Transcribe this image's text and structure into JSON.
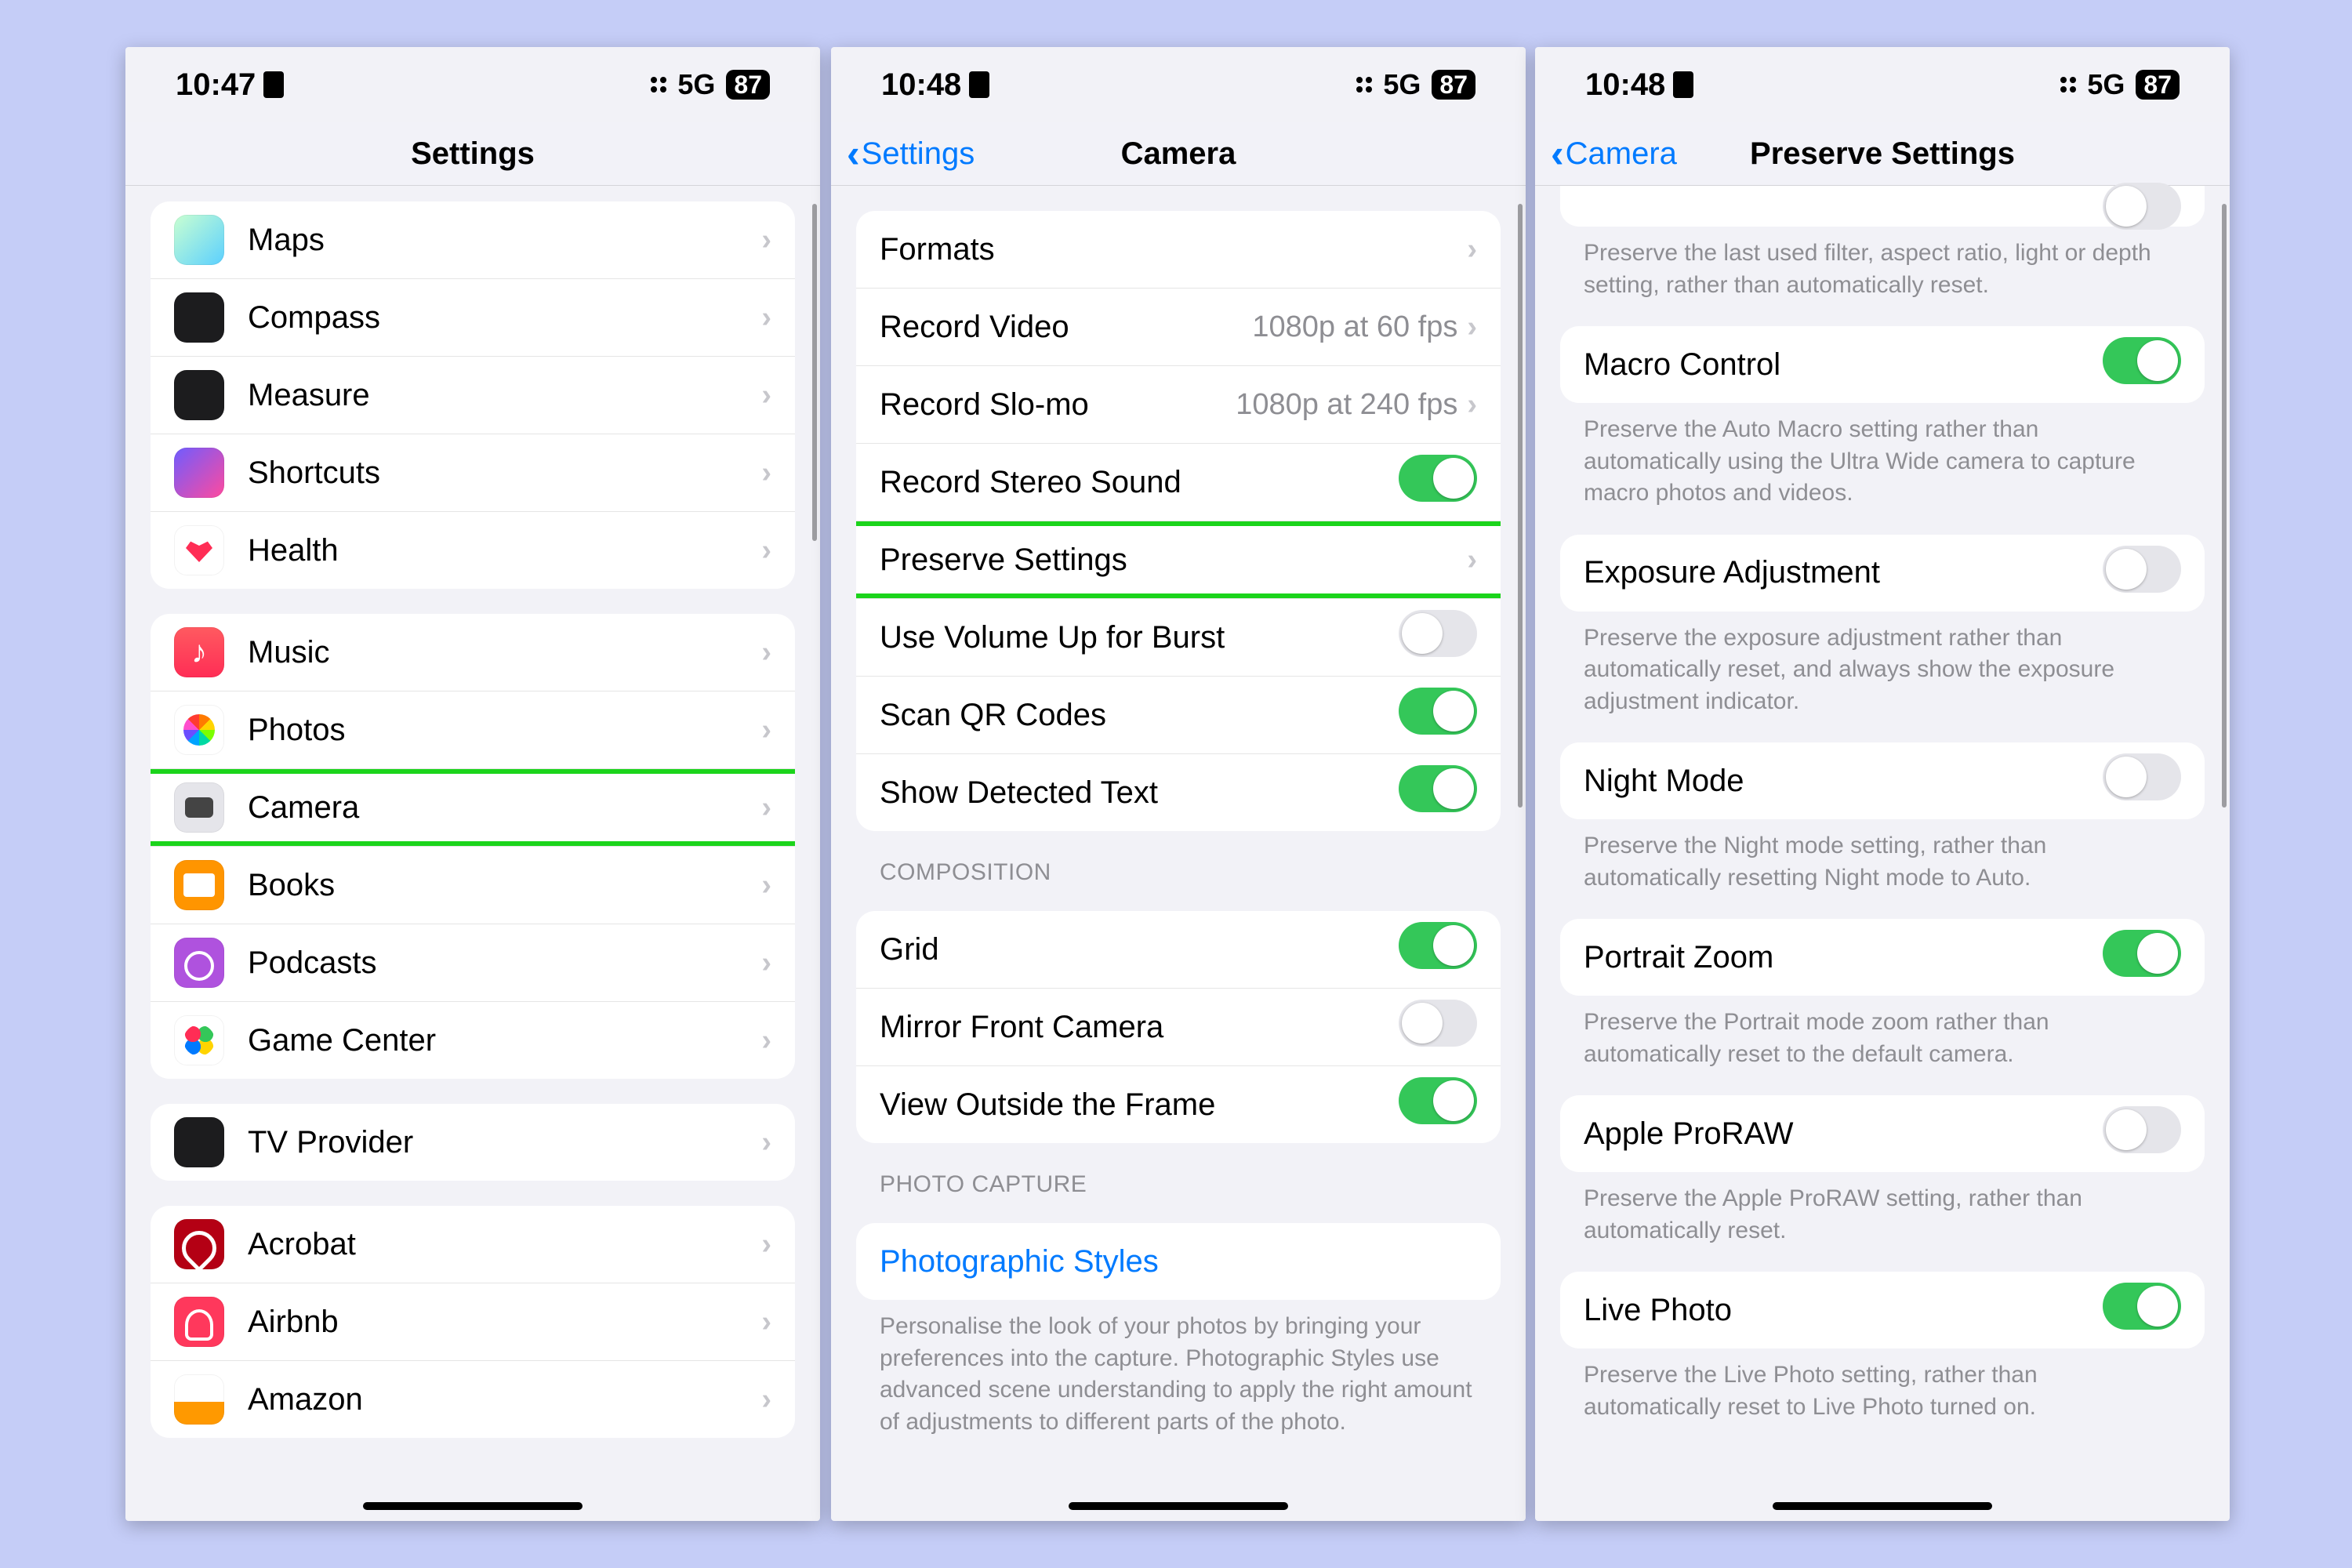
{
  "statusbar": {
    "network": "5G",
    "battery": "87"
  },
  "screen1": {
    "time": "10:47",
    "title": "Settings",
    "groups": [
      {
        "items": [
          {
            "icon": "ic-maps",
            "name": "maps",
            "label": "Maps"
          },
          {
            "icon": "ic-compass",
            "name": "compass",
            "label": "Compass"
          },
          {
            "icon": "ic-measure",
            "name": "measure",
            "label": "Measure"
          },
          {
            "icon": "ic-shortcuts",
            "name": "shortcuts",
            "label": "Shortcuts"
          },
          {
            "icon": "ic-health",
            "name": "health",
            "label": "Health"
          }
        ]
      },
      {
        "items": [
          {
            "icon": "ic-music",
            "name": "music",
            "label": "Music"
          },
          {
            "icon": "ic-photos",
            "name": "photos",
            "label": "Photos"
          },
          {
            "icon": "ic-camera",
            "name": "camera",
            "label": "Camera",
            "highlight": true
          },
          {
            "icon": "ic-books",
            "name": "books",
            "label": "Books"
          },
          {
            "icon": "ic-podcasts",
            "name": "podcasts",
            "label": "Podcasts"
          },
          {
            "icon": "ic-gamectr",
            "name": "game-center",
            "label": "Game Center"
          }
        ]
      },
      {
        "items": [
          {
            "icon": "ic-tvprov",
            "name": "tv-provider",
            "label": "TV Provider"
          }
        ]
      },
      {
        "items": [
          {
            "icon": "ic-acrobat",
            "name": "acrobat",
            "label": "Acrobat"
          },
          {
            "icon": "ic-airbnb",
            "name": "airbnb",
            "label": "Airbnb"
          },
          {
            "icon": "ic-amazon",
            "name": "amazon",
            "label": "Amazon"
          }
        ]
      }
    ]
  },
  "screen2": {
    "time": "10:48",
    "back": "Settings",
    "title": "Camera",
    "group1": [
      {
        "type": "nav",
        "name": "formats",
        "label": "Formats"
      },
      {
        "type": "nav",
        "name": "record-video",
        "label": "Record Video",
        "detail": "1080p at 60 fps"
      },
      {
        "type": "nav",
        "name": "record-slomo",
        "label": "Record Slo-mo",
        "detail": "1080p at 240 fps"
      },
      {
        "type": "toggle",
        "name": "record-stereo",
        "label": "Record Stereo Sound",
        "value": true
      },
      {
        "type": "nav",
        "name": "preserve-settings",
        "label": "Preserve Settings",
        "highlight": true
      },
      {
        "type": "toggle",
        "name": "volume-burst",
        "label": "Use Volume Up for Burst",
        "value": false
      },
      {
        "type": "toggle",
        "name": "scan-qr",
        "label": "Scan QR Codes",
        "value": true
      },
      {
        "type": "toggle",
        "name": "detected-text",
        "label": "Show Detected Text",
        "value": true
      }
    ],
    "headers": {
      "composition": "Composition",
      "photo_capture": "Photo Capture"
    },
    "group2": [
      {
        "type": "toggle",
        "name": "grid",
        "label": "Grid",
        "value": true
      },
      {
        "type": "toggle",
        "name": "mirror-front",
        "label": "Mirror Front Camera",
        "value": false
      },
      {
        "type": "toggle",
        "name": "view-outside-frame",
        "label": "View Outside the Frame",
        "value": true
      }
    ],
    "group3": [
      {
        "type": "link",
        "name": "photographic-styles",
        "label": "Photographic Styles"
      }
    ],
    "footer3": "Personalise the look of your photos by bringing your preferences into the capture. Photographic Styles use advanced scene understanding to apply the right amount of adjustments to different parts of the photo."
  },
  "screen3": {
    "time": "10:48",
    "back": "Camera",
    "title": "Preserve Settings",
    "topFooter": "Preserve the last used filter, aspect ratio, light or depth setting, rather than automatically reset.",
    "items": [
      {
        "name": "macro-control",
        "label": "Macro Control",
        "value": true,
        "footer": "Preserve the Auto Macro setting rather than automatically using the Ultra Wide camera to capture macro photos and videos."
      },
      {
        "name": "exposure-adjustment",
        "label": "Exposure Adjustment",
        "value": false,
        "footer": "Preserve the exposure adjustment rather than automatically reset, and always show the exposure adjustment indicator."
      },
      {
        "name": "night-mode",
        "label": "Night Mode",
        "value": false,
        "footer": "Preserve the Night mode setting, rather than automatically resetting Night mode to Auto."
      },
      {
        "name": "portrait-zoom",
        "label": "Portrait Zoom",
        "value": true,
        "footer": "Preserve the Portrait mode zoom rather than automatically reset to the default camera."
      },
      {
        "name": "apple-proraw",
        "label": "Apple ProRAW",
        "value": false,
        "footer": "Preserve the Apple ProRAW setting, rather than automatically reset."
      },
      {
        "name": "live-photo",
        "label": "Live Photo",
        "value": true,
        "footer": "Preserve the Live Photo setting, rather than automatically reset to Live Photo turned on."
      }
    ]
  }
}
